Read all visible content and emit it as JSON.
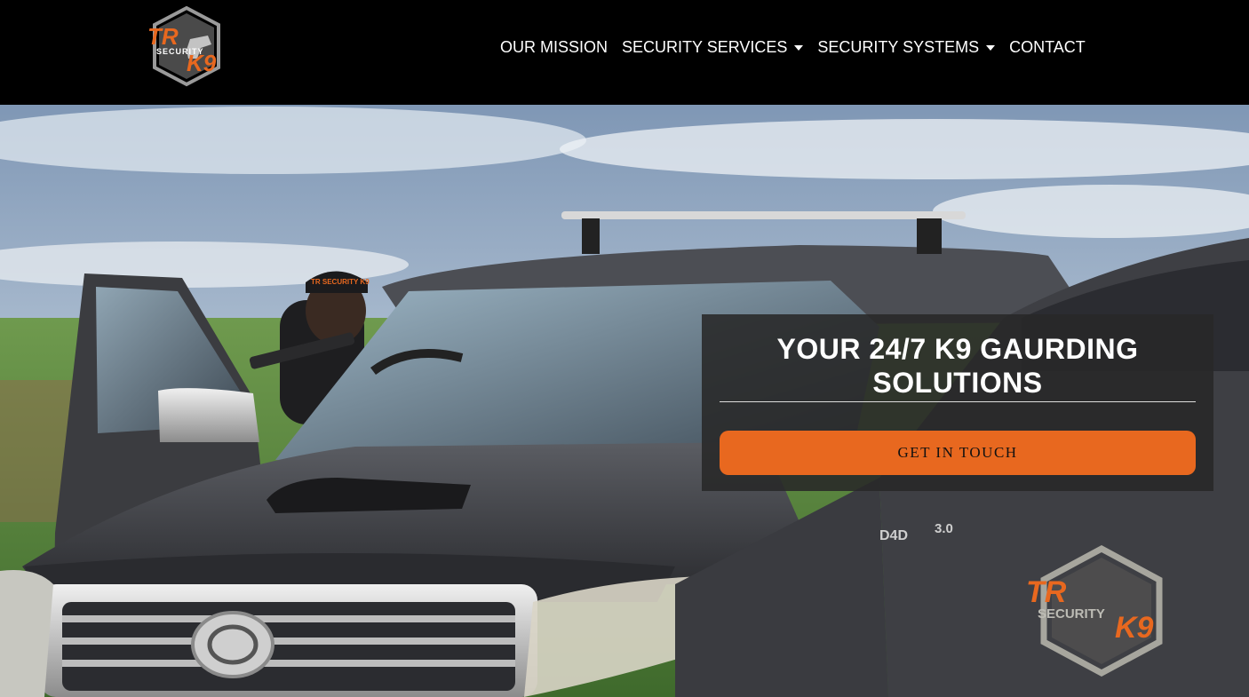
{
  "brand": {
    "logo_text_top": "TR",
    "logo_text_middle": "SECURITY",
    "logo_text_bottom": "K9",
    "accent_color": "#e8681f"
  },
  "nav": {
    "items": [
      {
        "label": "OUR MISSION",
        "dropdown": false
      },
      {
        "label": "SECURITY SERVICES",
        "dropdown": true
      },
      {
        "label": "SECURITY SYSTEMS",
        "dropdown": true
      },
      {
        "label": "CONTACT",
        "dropdown": false
      }
    ]
  },
  "hero": {
    "heading": "YOUR 24/7 K9 GAURDING SOLUTIONS",
    "cta_label": "GET IN TOUCH",
    "vehicle_badge": "3.0",
    "vehicle_model": "D4D",
    "door_logo_top": "TR",
    "door_logo_middle": "SECURITY",
    "door_logo_bottom": "K9",
    "cap_text": "TR SECURITY K9"
  }
}
